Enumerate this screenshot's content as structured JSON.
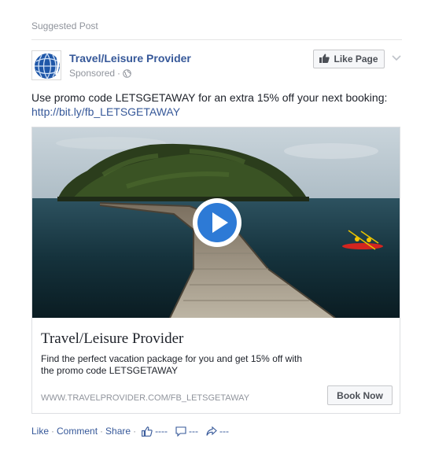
{
  "header": {
    "suggested_label": "Suggested Post"
  },
  "author": {
    "name": "Travel/Leisure Provider",
    "sponsored_label": "Sponsored",
    "dot": "·",
    "like_page_label": "Like Page"
  },
  "post": {
    "text": "Use promo code LETSGETAWAY for an extra 15% off your next booking:",
    "link": "http://bit.ly/fb_LETSGETAWAY"
  },
  "card": {
    "title": "Travel/Leisure Provider",
    "description": "Find the perfect vacation package for you and get 15% off with the promo code LETSGETAWAY",
    "url": "WWW.TRAVELPROVIDER.COM/FB_LETSGETAWAY",
    "cta_label": "Book Now"
  },
  "actions": {
    "like": "Like",
    "comment": "Comment",
    "share": "Share",
    "separator": "·",
    "like_count": "----",
    "comment_count": "---",
    "share_count": "---"
  },
  "colors": {
    "link": "#365899",
    "muted": "#90949c",
    "play": "#2d7ad6"
  },
  "icons": [
    "globe-icon",
    "thumbs-up-icon",
    "chevron-down-icon",
    "play-icon",
    "comment-icon",
    "share-icon"
  ]
}
